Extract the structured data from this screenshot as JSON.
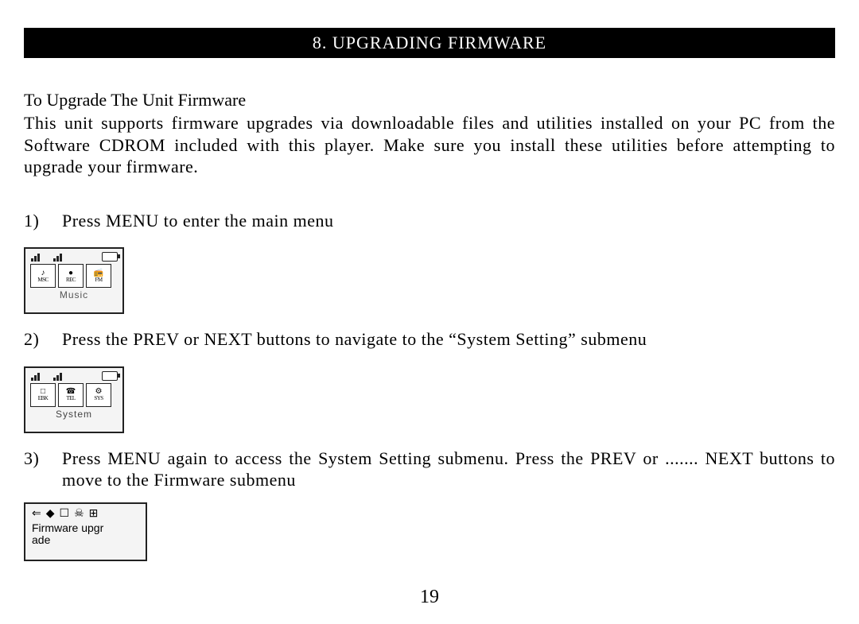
{
  "header": {
    "section_title": "8.  UPGRADING FIRMWARE"
  },
  "subtitle": "To Upgrade The Unit Firmware",
  "intro": "This unit supports firmware upgrades via downloadable files and utilities installed on your PC from the Software CDROM included with this player.  Make sure you install these utilities before attempting to upgrade your firmware.",
  "steps": [
    {
      "num": "1)",
      "text": "Press MENU to enter the main menu"
    },
    {
      "num": "2)",
      "text": "Press the PREV or NEXT buttons to navigate to the “System Setting” submenu"
    },
    {
      "num": "3)",
      "text": "Press MENU again to access the System Setting submenu.  Press the PREV or  ....... NEXT buttons to move to the Firmware submenu"
    }
  ],
  "figures": {
    "music": {
      "cells": [
        {
          "top": "♪",
          "bottom": "MSC"
        },
        {
          "top": "●",
          "bottom": "REC"
        },
        {
          "top": "📻",
          "bottom": "FM"
        }
      ],
      "label": "Music"
    },
    "system": {
      "cells": [
        {
          "top": "□",
          "bottom": "EBK"
        },
        {
          "top": "☎",
          "bottom": "TEL"
        },
        {
          "top": "⚙",
          "bottom": "SYS"
        }
      ],
      "label": "System"
    },
    "firmware": {
      "icons": [
        "⇐",
        "◆",
        "☐",
        "☠",
        "⊞"
      ],
      "text_line1": "Firmware upgr",
      "text_line2": "ade"
    }
  },
  "page_number": "19",
  "colors": {
    "header_bg": "#000000",
    "header_text": "#ffffff",
    "body_text": "#000000",
    "page_bg": "#ffffff"
  }
}
